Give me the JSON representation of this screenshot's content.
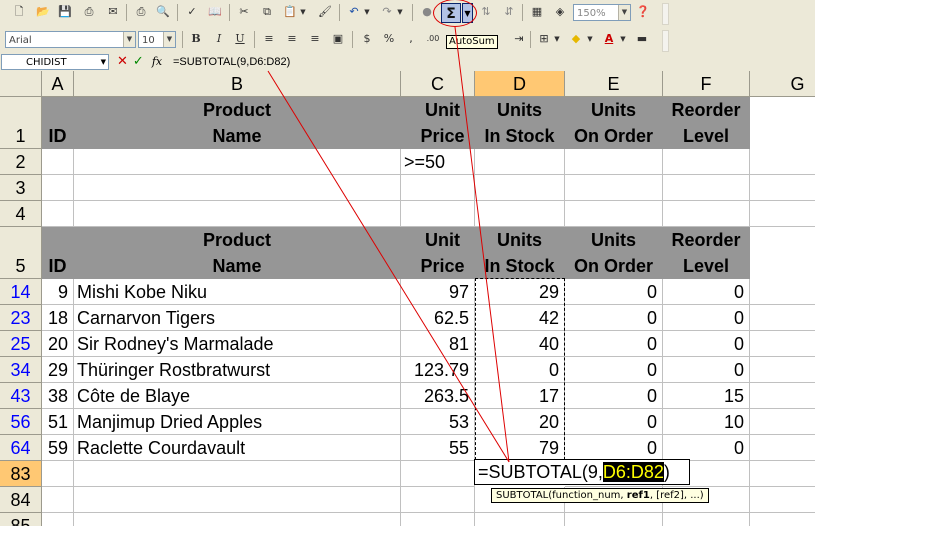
{
  "toolbar": {
    "font_name": "Arial",
    "font_size": "10",
    "zoom": "150%",
    "sigma_symbol": "Σ",
    "autosum_tooltip": "AutoSum",
    "buttons_row2": [
      "B",
      "I",
      "U",
      "$",
      "%",
      ",",
      ".00",
      "A"
    ]
  },
  "formula_bar": {
    "name_box": "CHIDIST",
    "formula": "=SUBTOTAL(9,D6:D82)",
    "fx": "fx"
  },
  "columns": [
    "A",
    "B",
    "C",
    "D",
    "E",
    "F",
    "G"
  ],
  "header_rows": {
    "id": "ID",
    "product_name": [
      "Product",
      "Name"
    ],
    "unit_price": [
      "Unit",
      "Price"
    ],
    "units_in_stock": [
      "Units",
      "In Stock"
    ],
    "units_on_order": [
      "Units",
      "On Order"
    ],
    "reorder_level": [
      "Reorder",
      "Level"
    ]
  },
  "criteria": ">=50",
  "row_numbers": [
    "1",
    "2",
    "3",
    "4",
    "5",
    "14",
    "23",
    "25",
    "34",
    "43",
    "56",
    "64",
    "83",
    "84",
    "85"
  ],
  "data_rows": [
    {
      "row": "14",
      "id": "9",
      "name": "Mishi Kobe Niku",
      "price": "97",
      "stock": "29",
      "order": "0",
      "reorder": "0"
    },
    {
      "row": "23",
      "id": "18",
      "name": "Carnarvon Tigers",
      "price": "62.5",
      "stock": "42",
      "order": "0",
      "reorder": "0"
    },
    {
      "row": "25",
      "id": "20",
      "name": "Sir Rodney's Marmalade",
      "price": "81",
      "stock": "40",
      "order": "0",
      "reorder": "0"
    },
    {
      "row": "34",
      "id": "29",
      "name": "Thüringer Rostbratwurst",
      "price": "123.79",
      "stock": "0",
      "order": "0",
      "reorder": "0"
    },
    {
      "row": "43",
      "id": "38",
      "name": "Côte de Blaye",
      "price": "263.5",
      "stock": "17",
      "order": "0",
      "reorder": "15"
    },
    {
      "row": "56",
      "id": "51",
      "name": "Manjimup Dried Apples",
      "price": "53",
      "stock": "20",
      "order": "0",
      "reorder": "10"
    },
    {
      "row": "64",
      "id": "59",
      "name": "Raclette Courdavault",
      "price": "55",
      "stock": "79",
      "order": "0",
      "reorder": "0"
    }
  ],
  "edit_cell": {
    "prefix": "=SUBTOTAL(9,",
    "ref": "D6:D82",
    "suffix": ")"
  },
  "fn_tooltip": {
    "start": "SUBTOTAL(function_num, ",
    "bold": "ref1",
    "end": ", [ref2], ...)"
  },
  "colors": {
    "header_gray": "#969696",
    "selected_col": "#ffc873",
    "annotation_red": "#dd0000",
    "row_number_blue": "#0000ff"
  }
}
